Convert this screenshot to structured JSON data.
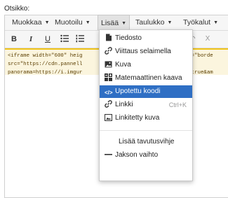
{
  "field_label": "Otsikko:",
  "menubar": {
    "items": [
      {
        "label": "Muokkaa"
      },
      {
        "label": "Muotoilu"
      },
      {
        "label": "Lisää"
      },
      {
        "label": "Taulukko"
      },
      {
        "label": "Työkalut"
      }
    ]
  },
  "toolbar": {
    "bold": "B",
    "italic": "I",
    "underline": "U",
    "extra": "X"
  },
  "code_lines": [
    "<iframe width=\"600\" heig                              style=\"borde",
    "src=\"https://cdn.pannell",
    "panorama=https://i.imgur                               oad=true&am"
  ],
  "insert_menu": {
    "items": [
      {
        "label": "Tiedosto",
        "icon": "file-icon"
      },
      {
        "label": "Viittaus selaimella",
        "icon": "link-icon"
      },
      {
        "label": "Kuva",
        "icon": "image-icon"
      },
      {
        "label": "Matemaattinen kaava",
        "icon": "formula-icon"
      },
      {
        "label": "Upotettu koodi",
        "icon": "code-icon",
        "active": true
      },
      {
        "label": "Linkki",
        "icon": "link-icon",
        "shortcut": "Ctrl+K"
      },
      {
        "label": "Linkitetty kuva",
        "icon": "linked-image-icon"
      },
      {
        "label": "Lisää tavutusvihje"
      },
      {
        "label": "Jakson vaihto",
        "icon": "horizontal-rule-icon"
      }
    ]
  },
  "colors": {
    "active_bg": "#2f6fc4",
    "code_bg": "#fbf5de",
    "code_border": "#f0c419"
  }
}
